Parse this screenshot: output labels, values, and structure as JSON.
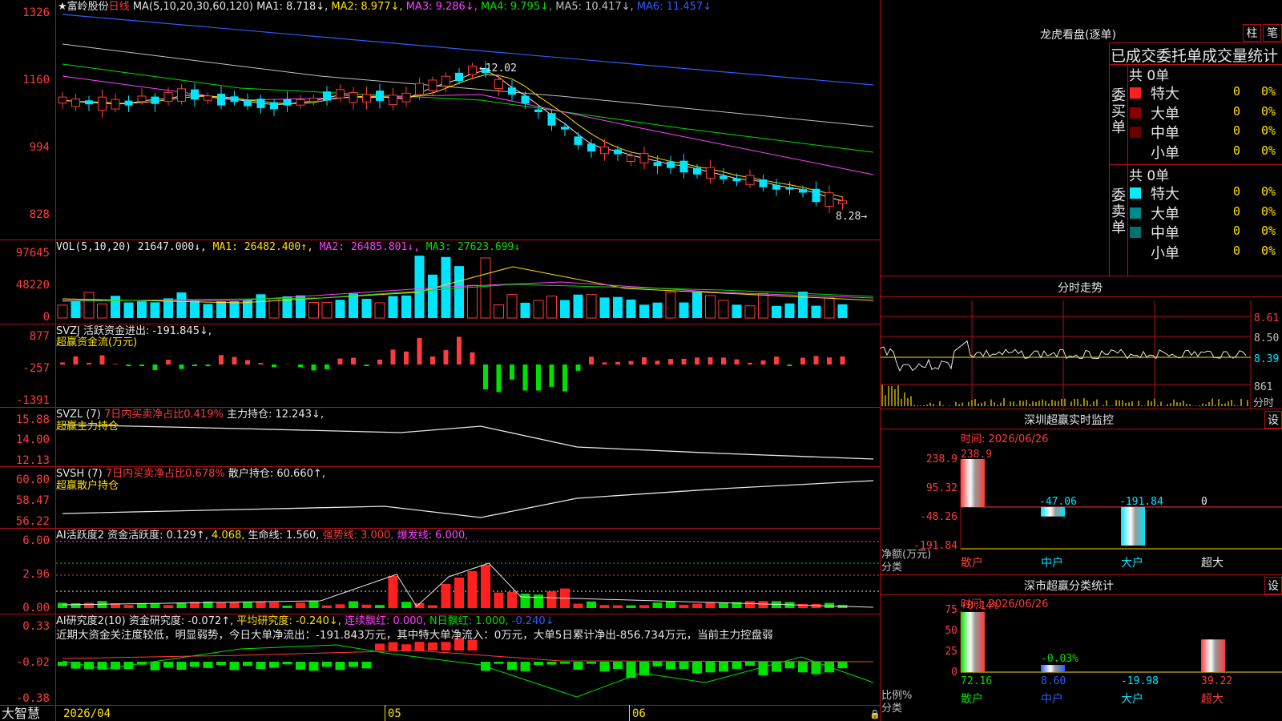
{
  "chart_header": {
    "star": "★",
    "stock_name": "富岭股份",
    "period": "日线",
    "ma_params": "MA(5,10,20,30,60,120)",
    "ma1": "MA1: 8.718↓,",
    "ma2": "MA2: 8.977↓,",
    "ma3": "MA3: 9.286↓,",
    "ma4": "MA4: 9.795↓,",
    "ma5": "MA5: 10.417↓,",
    "ma6": "MA6: 11.457↓"
  },
  "price_axis": [
    "1326",
    "1160",
    "994",
    "828"
  ],
  "price_annotations": {
    "high": "12.02",
    "low": "8.28"
  },
  "vol_header": {
    "params": "VOL(5,10,20)",
    "value": "21647.000↓,",
    "ma1": "MA1: 26482.400↑,",
    "ma2": "MA2: 26485.801↓,",
    "ma3": "MA3: 27623.699↓"
  },
  "vol_axis": [
    "97645",
    "48220",
    "0"
  ],
  "svzj_header": {
    "name": "SVZJ",
    "label": "活跃资金进出: -191.845↓,",
    "sub": "超赢资金流(万元)"
  },
  "svzj_axis": [
    "877",
    "-257",
    "-1391"
  ],
  "svzl_header": {
    "name": "SVZL (7)",
    "ratio": "7日内买卖净占比0.419%",
    "hold": "主力持仓: 12.243↓,",
    "sub": "超赢主力持仓"
  },
  "svzl_axis": [
    "15.88",
    "14.00",
    "12.13"
  ],
  "svsh_header": {
    "name": "SVSH (7)",
    "ratio": "7日内买卖净占比0.678%",
    "hold": "散户持仓: 60.660↑,",
    "sub": "超赢散户持仓"
  },
  "svsh_axis": [
    "60.80",
    "58.47",
    "56.22"
  ],
  "ai1_header": {
    "name": "AI活跃度2",
    "a": "资金活跃度: 0.129↑,",
    "b": "4.068,",
    "c": "生命线: 1.560,",
    "d": "强势线: 3.000,",
    "e": "爆发线: 6.000,"
  },
  "ai1_axis": [
    "6.00",
    "2.96",
    "0.00"
  ],
  "ai2_header": {
    "name": "AI研究度2(10)",
    "a": "资金研究度: -0.072↑,",
    "b": "平均研究度: -0.240↓,",
    "c": "连续飘红: 0.000,",
    "d": "N日飘红: 1.000,",
    "e": "-0.240↓"
  },
  "ai2_comment": "近期大资金关注度较低，明显弱势，今日大单净流出：-191.843万元，其中特大单净流入：0万元，大单5日累计净出-856.734万元，当前主力控盘弱",
  "ai2_axis": [
    "0.33",
    "-0.02",
    "-0.38"
  ],
  "bottom": {
    "brand": "大智慧",
    "date": "2026/04",
    "m05": "05",
    "m06": "06"
  },
  "lhb": {
    "title": "龙虎看盘(逐单)",
    "btn1": "柱",
    "btn2": "笔",
    "stat_title": "已成交委托单成交量统计",
    "buy": {
      "label": "委买单",
      "total": "共 0单",
      "rows": [
        {
          "name": "特大",
          "v": "0",
          "p": "0%"
        },
        {
          "name": "大单",
          "v": "0",
          "p": "0%"
        },
        {
          "name": "中单",
          "v": "0",
          "p": "0%"
        },
        {
          "name": "小单",
          "v": "0",
          "p": "0%"
        }
      ]
    },
    "sell": {
      "label": "委卖单",
      "total": "共 0单",
      "rows": [
        {
          "name": "特大",
          "v": "0",
          "p": "0%"
        },
        {
          "name": "大单",
          "v": "0",
          "p": "0%"
        },
        {
          "name": "中单",
          "v": "0",
          "p": "0%"
        },
        {
          "name": "小单",
          "v": "0",
          "p": "0%"
        }
      ]
    }
  },
  "fenshi": {
    "title": "分时走势",
    "axis": [
      "8.61",
      "8.50",
      "8.39"
    ],
    "vol": "861",
    "vol_label": "分时"
  },
  "monitor": {
    "title": "深圳超赢实时监控",
    "btn": "设",
    "time": "时间: 2026/06/26",
    "axis": [
      "238.9",
      "95.32",
      "-48.26",
      "-191.84"
    ],
    "values": [
      {
        "name": "散户",
        "value": "238.9"
      },
      {
        "name": "中户",
        "value": "-47.06"
      },
      {
        "name": "大户",
        "value": "-191.84"
      },
      {
        "name": "超大",
        "value": "0"
      }
    ],
    "ylabel": "净额(万元)",
    "xlabel": "分类"
  },
  "classify": {
    "title": "深市超赢分类统计",
    "btn": "设",
    "time": "时间: 2026/06/26",
    "axis": [
      "75",
      "50",
      "25",
      "0"
    ],
    "top_labels": [
      "+0.14%",
      "-0.03%"
    ],
    "values": [
      {
        "name": "散户",
        "value": "72.16"
      },
      {
        "name": "中户",
        "value": "8.60"
      },
      {
        "name": "大户",
        "value": "-19.98"
      },
      {
        "name": "超大",
        "value": "39.22"
      }
    ],
    "ylabel": "比例%",
    "xlabel": "分类"
  },
  "colors": {
    "up": "#ff3b3b",
    "down": "#00e5ff",
    "grid": "#b01010"
  }
}
